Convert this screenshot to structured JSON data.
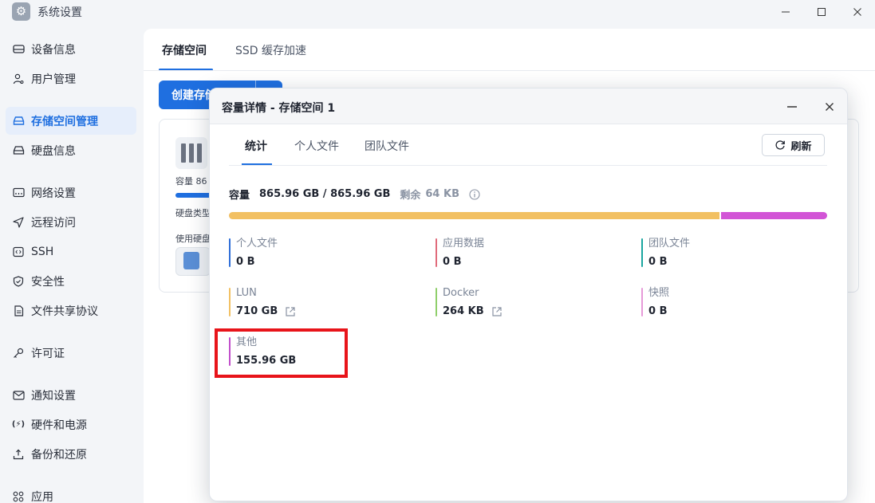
{
  "window": {
    "title": "系统设置",
    "icon": "gear-icon"
  },
  "sidebar": {
    "items": [
      {
        "label": "设备信息",
        "icon": "device-icon"
      },
      {
        "label": "用户管理",
        "icon": "user-icon"
      },
      {
        "label": "存储空间管理",
        "icon": "storage-icon",
        "active": true
      },
      {
        "label": "硬盘信息",
        "icon": "disk-icon"
      },
      {
        "label": "网络设置",
        "icon": "network-icon"
      },
      {
        "label": "远程访问",
        "icon": "send-icon"
      },
      {
        "label": "SSH",
        "icon": "terminal-icon"
      },
      {
        "label": "安全性",
        "icon": "shield-icon"
      },
      {
        "label": "文件共享协议",
        "icon": "file-icon"
      },
      {
        "label": "许可证",
        "icon": "key-icon"
      },
      {
        "label": "通知设置",
        "icon": "mail-icon"
      },
      {
        "label": "硬件和电源",
        "icon": "power-icon"
      },
      {
        "label": "备份和还原",
        "icon": "backup-icon"
      },
      {
        "label": "应用",
        "icon": "apps-icon"
      }
    ]
  },
  "main": {
    "tabs": [
      {
        "label": "存储空间",
        "active": true
      },
      {
        "label": "SSD 缓存加速",
        "active": false
      }
    ],
    "create_button": "创建存储空间",
    "card": {
      "capacity_label": "容量  86",
      "disk_type_label": "硬盘类型",
      "used_disks_label": "使用硬盘"
    }
  },
  "dialog": {
    "title": "容量详情 - 存储空间 1",
    "tabs": [
      {
        "label": "统计",
        "active": true
      },
      {
        "label": "个人文件",
        "active": false
      },
      {
        "label": "团队文件",
        "active": false
      }
    ],
    "refresh_label": "刷新",
    "capacity": {
      "label": "容量",
      "value": "865.96 GB / 865.96 GB",
      "remaining_label": "剩余",
      "remaining_value": "64 KB"
    },
    "capacity_bar": [
      {
        "name": "LUN",
        "fraction": 0.8199,
        "color": "#f2c062"
      },
      {
        "name": "其他",
        "fraction": 0.1801,
        "color": "#d254d6"
      }
    ],
    "stats": [
      {
        "label": "个人文件",
        "value": "0 B",
        "color": "#2f6fd8",
        "link": false
      },
      {
        "label": "应用数据",
        "value": "0 B",
        "color": "#e06b7b",
        "link": false
      },
      {
        "label": "团队文件",
        "value": "0 B",
        "color": "#1aa6a0",
        "link": false
      },
      {
        "label": "LUN",
        "value": "710 GB",
        "color": "#f2c062",
        "link": true
      },
      {
        "label": "Docker",
        "value": "264 KB",
        "color": "#8fcf6b",
        "link": true
      },
      {
        "label": "快照",
        "value": "0 B",
        "color": "#e69ad8",
        "link": false
      },
      {
        "label": "其他",
        "value": "155.96 GB",
        "color": "#c14ecb",
        "link": false
      }
    ]
  }
}
